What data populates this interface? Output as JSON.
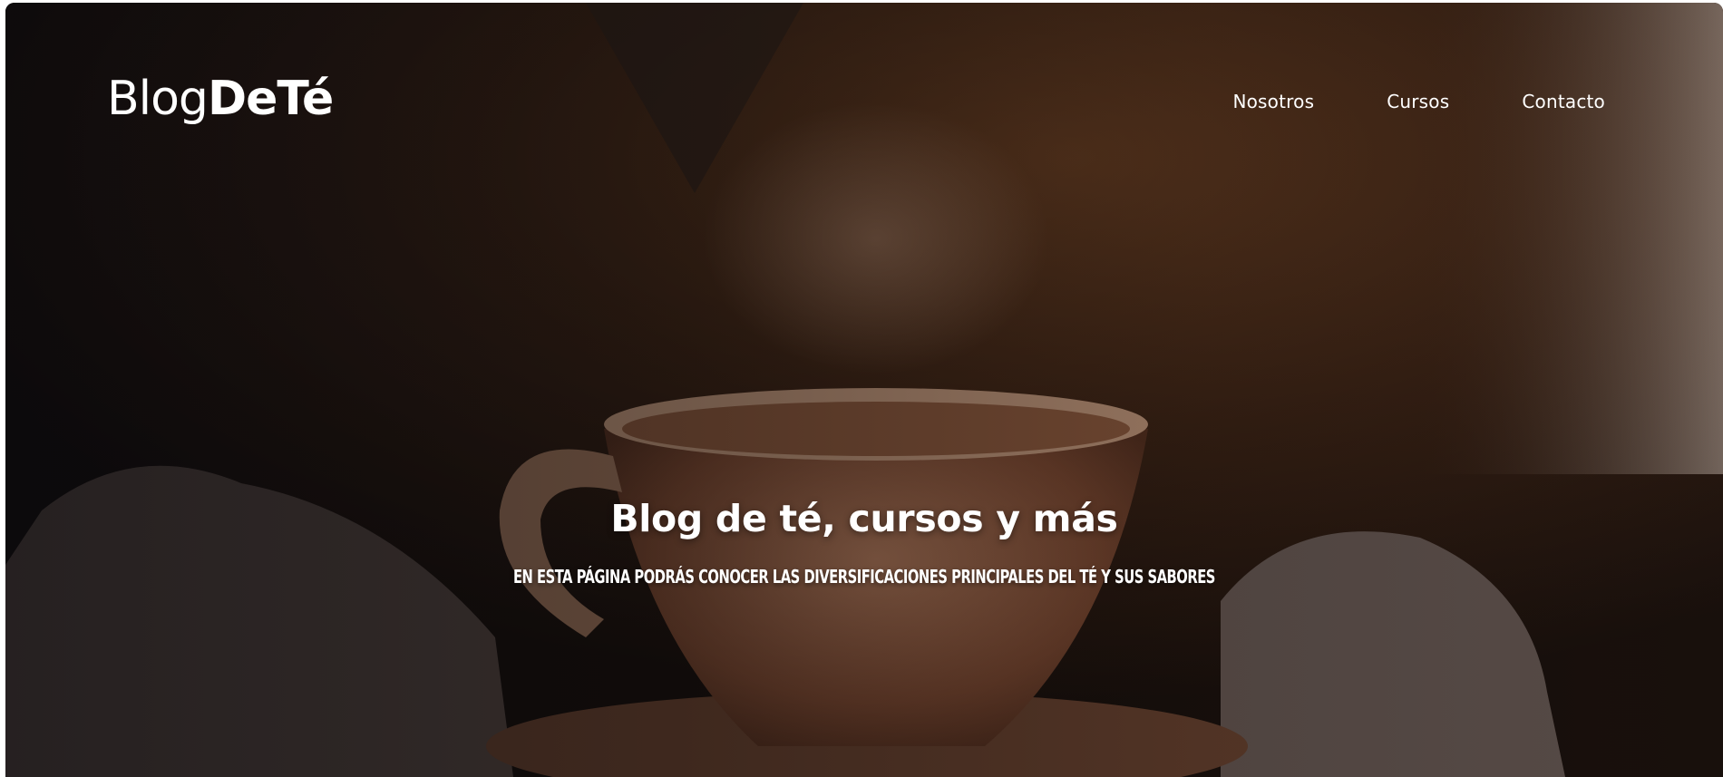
{
  "brand": {
    "logo_light": "Blog",
    "logo_bold": "DeTé"
  },
  "nav": {
    "items": [
      {
        "label": "Nosotros"
      },
      {
        "label": "Cursos"
      },
      {
        "label": "Contacto"
      }
    ]
  },
  "hero": {
    "title": "Blog de té, cursos y más",
    "subtitle": "En esta página podrás conocer las diversificaciones principales del té y sus sabores",
    "background_image": "tea-cup-photo"
  },
  "colors": {
    "text": "#ffffff",
    "background_dark": "#1a120d"
  }
}
